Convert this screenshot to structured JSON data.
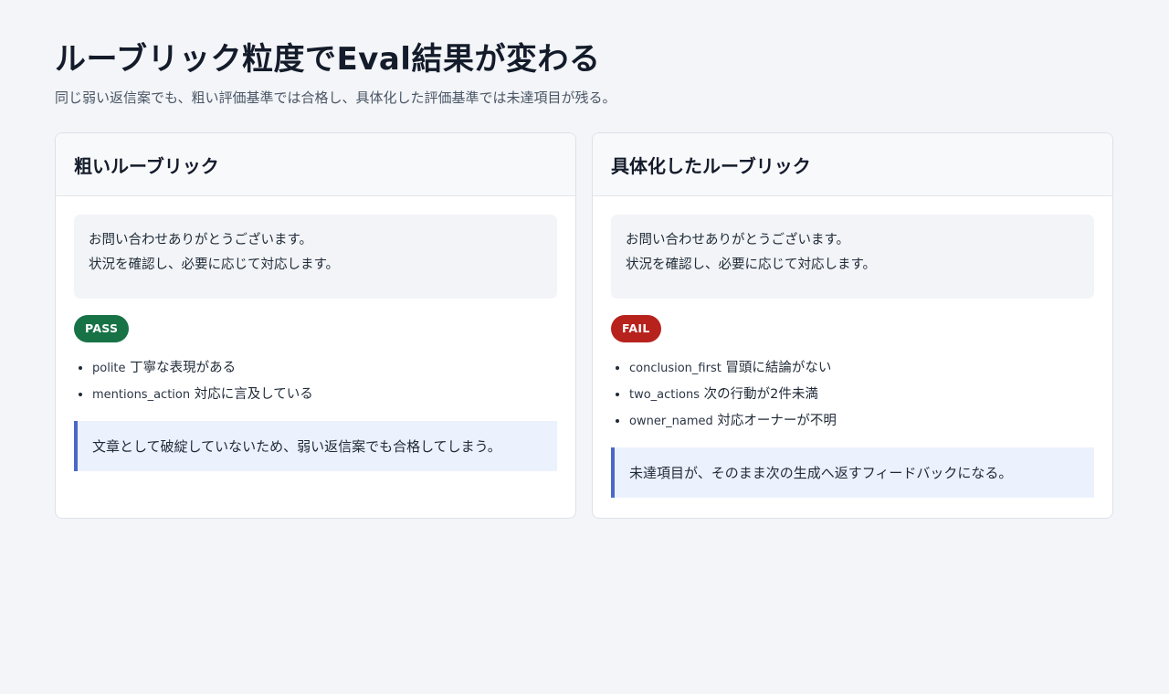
{
  "page": {
    "title": "ルーブリック粒度でEval結果が変わる",
    "subtitle": "同じ弱い返信案でも、粗い評価基準では合格し、具体化した評価基準では未達項目が残る。"
  },
  "cards": [
    {
      "title": "粗いルーブリック",
      "reply_lines": [
        "お問い合わせありがとうございます。",
        "状況を確認し、必要に応じて対応します。"
      ],
      "badge": "PASS",
      "criteria": [
        {
          "key": "polite",
          "text": "丁寧な表現がある"
        },
        {
          "key": "mentions_action",
          "text": "対応に言及している"
        }
      ],
      "note": "文章として破綻していないため、弱い返信案でも合格してしまう。"
    },
    {
      "title": "具体化したルーブリック",
      "reply_lines": [
        "お問い合わせありがとうございます。",
        "状況を確認し、必要に応じて対応します。"
      ],
      "badge": "FAIL",
      "criteria": [
        {
          "key": "conclusion_first",
          "text": "冒頭に結論がない"
        },
        {
          "key": "two_actions",
          "text": "次の行動が2件未満"
        },
        {
          "key": "owner_named",
          "text": "対応オーナーが不明"
        }
      ],
      "note": "未達項目が、そのまま次の生成へ返すフィードバックになる。"
    }
  ],
  "colors": {
    "pass": "#177245",
    "fail": "#b7221d",
    "note_accent": "#4b68c9",
    "background": "#f3f5f8"
  }
}
